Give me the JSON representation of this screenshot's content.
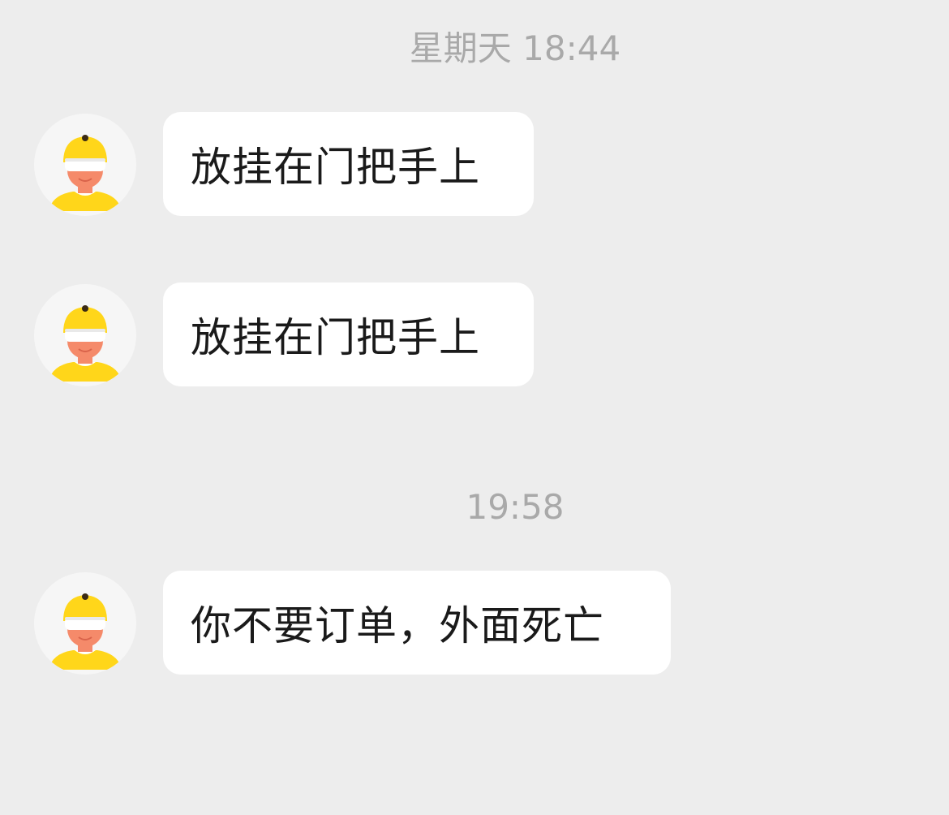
{
  "chat": {
    "timestamps": [
      "星期天 18:44",
      "19:58"
    ],
    "messages": [
      {
        "sender": "courier",
        "avatar_icon": "delivery-rider-avatar-icon",
        "text": "放挂在门把手上"
      },
      {
        "sender": "courier",
        "avatar_icon": "delivery-rider-avatar-icon",
        "text": "放挂在门把手上"
      },
      {
        "sender": "courier",
        "avatar_icon": "delivery-rider-avatar-icon",
        "text": "你不要订单，外面死亡"
      }
    ]
  },
  "colors": {
    "background": "#ededed",
    "bubble": "#ffffff",
    "timestamp_text": "#a9a9a9",
    "message_text": "#1a1a1a",
    "helmet_yellow": "#ffd61a",
    "skin": "#f58a6a"
  }
}
